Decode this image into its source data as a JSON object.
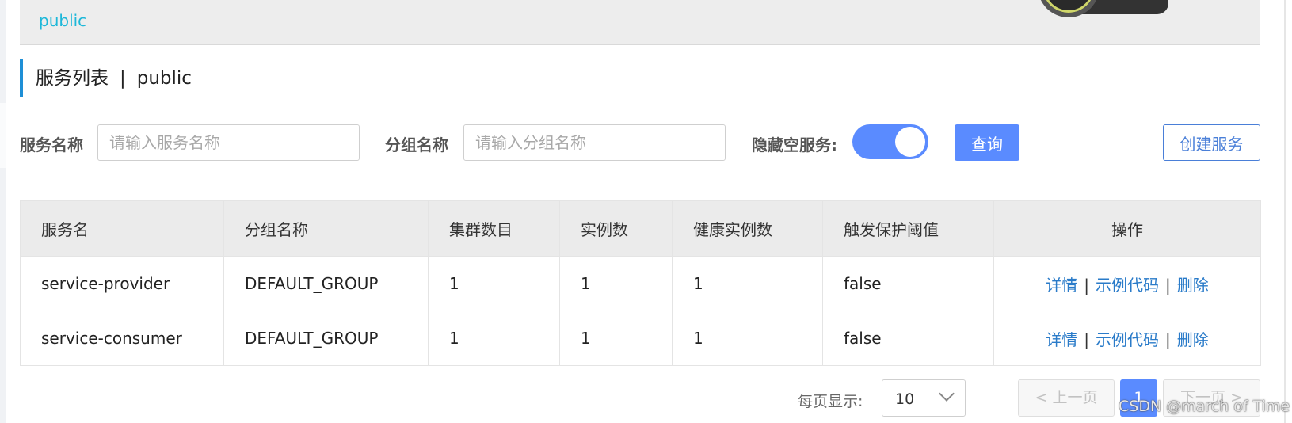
{
  "namespace_bar": {
    "link": "public"
  },
  "title": {
    "main": "服务列表",
    "separator": "|",
    "namespace": "public"
  },
  "filters": {
    "service_name_label": "服务名称",
    "service_name_placeholder": "请输入服务名称",
    "group_name_label": "分组名称",
    "group_name_placeholder": "请输入分组名称",
    "hide_empty_label": "隐藏空服务:",
    "hide_empty_on": true,
    "query_button": "查询",
    "create_button": "创建服务"
  },
  "table": {
    "columns": [
      "服务名",
      "分组名称",
      "集群数目",
      "实例数",
      "健康实例数",
      "触发保护阈值",
      "操作"
    ],
    "rows": [
      {
        "service": "service-provider",
        "group": "DEFAULT_GROUP",
        "clusters": "1",
        "instances": "1",
        "healthy": "1",
        "threshold": "false"
      },
      {
        "service": "service-consumer",
        "group": "DEFAULT_GROUP",
        "clusters": "1",
        "instances": "1",
        "healthy": "1",
        "threshold": "false"
      }
    ],
    "actions": {
      "detail": "详情",
      "sep": "|",
      "sample_code": "示例代码",
      "delete": "删除"
    }
  },
  "pagination": {
    "page_size_label": "每页显示:",
    "page_size": "10",
    "prev": "< 上一页",
    "current": "1",
    "next": "下一页 >"
  },
  "watermark": "CSDN @march of Time",
  "colors": {
    "primary": "#5a8bff",
    "link": "#2a7bc9",
    "namespace": "#1eb8d9",
    "title_bar": "#1e8fd6"
  }
}
